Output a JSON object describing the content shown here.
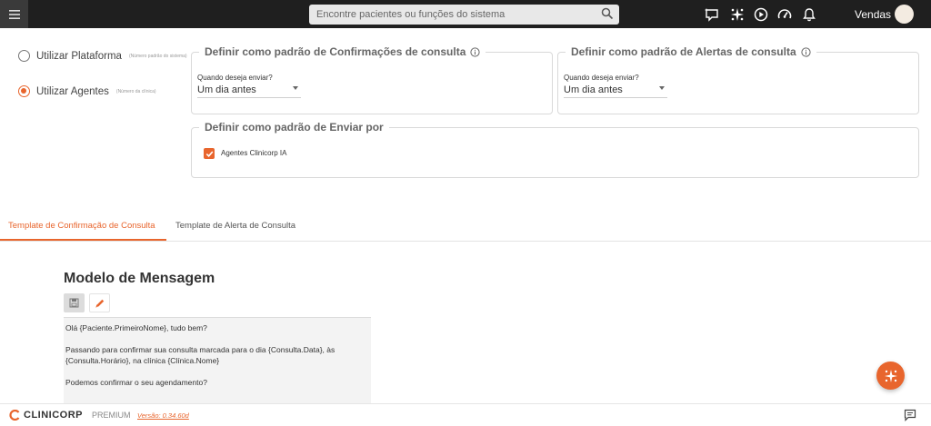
{
  "header": {
    "search_placeholder": "Encontre pacientes ou funções do sistema",
    "user_name": "Vendas",
    "icons": [
      "menu-icon",
      "search-icon",
      "ai-chat-icon",
      "sparkle-icon",
      "play-icon",
      "speedometer-icon",
      "bell-icon"
    ]
  },
  "platform_options": [
    {
      "label": "Utilizar Plataforma",
      "hint": "(Número padrão do sistema)",
      "checked": false
    },
    {
      "label": "Utilizar Agentes",
      "hint": "(Número da clínica)",
      "checked": true
    }
  ],
  "confirmations": {
    "title": "Definir como padrão de Confirmações de consulta",
    "when_label": "Quando deseja enviar?",
    "when_value": "Um dia antes"
  },
  "alerts": {
    "title": "Definir como padrão de Alertas de consulta",
    "when_label": "Quando deseja enviar?",
    "when_value": "Um dia antes"
  },
  "send_by": {
    "title": "Definir como padrão de Enviar por",
    "option_label": "Agentes Clinicorp IA",
    "option_checked": true
  },
  "tabs": [
    {
      "label": "Template de Confirmação de Consulta",
      "active": true
    },
    {
      "label": "Template de Alerta de Consulta",
      "active": false
    }
  ],
  "message_model": {
    "title": "Modelo de Mensagem",
    "lines": [
      "Olá {Paciente.PrimeiroNome}, tudo bem?",
      "",
      "Passando para confirmar sua consulta marcada para o dia {Consulta.Data}, às {Consulta.Horário}, na clínica {Clínica.Nome}",
      "",
      "Podemos confirmar o seu agendamento?"
    ]
  },
  "footer": {
    "brand": "CLINICORP",
    "plan": "PREMIUM",
    "version": "Versão: 0.34.60d"
  },
  "colors": {
    "accent": "#e8652d",
    "topbar": "#1f1f1f"
  }
}
